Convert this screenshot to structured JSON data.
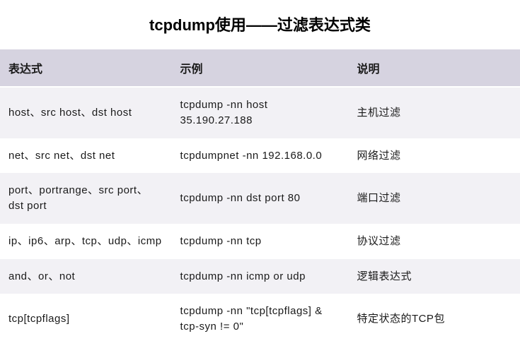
{
  "title": "tcpdump使用——过滤表达式类",
  "headers": {
    "col1": "表达式",
    "col2": "示例",
    "col3": "说明"
  },
  "rows": [
    {
      "expr": "host、src host、dst host",
      "example": "tcpdump -nn host 35.190.27.188",
      "desc": "主机过滤"
    },
    {
      "expr": "net、src net、dst net",
      "example": "tcpdumpnet -nn 192.168.0.0",
      "desc": "网络过滤"
    },
    {
      "expr": "port、portrange、src port、dst port",
      "example": "tcpdump -nn dst port 80",
      "desc": "端口过滤"
    },
    {
      "expr": "ip、ip6、arp、tcp、udp、icmp",
      "example": "tcpdump -nn tcp",
      "desc": "协议过滤"
    },
    {
      "expr": "and、or、not",
      "example": "tcpdump -nn icmp or udp",
      "desc": "逻辑表达式"
    },
    {
      "expr": "tcp[tcpflags]",
      "example": "tcpdump -nn \"tcp[tcpflags] & tcp-syn != 0\"",
      "desc": "特定状态的TCP包"
    }
  ]
}
